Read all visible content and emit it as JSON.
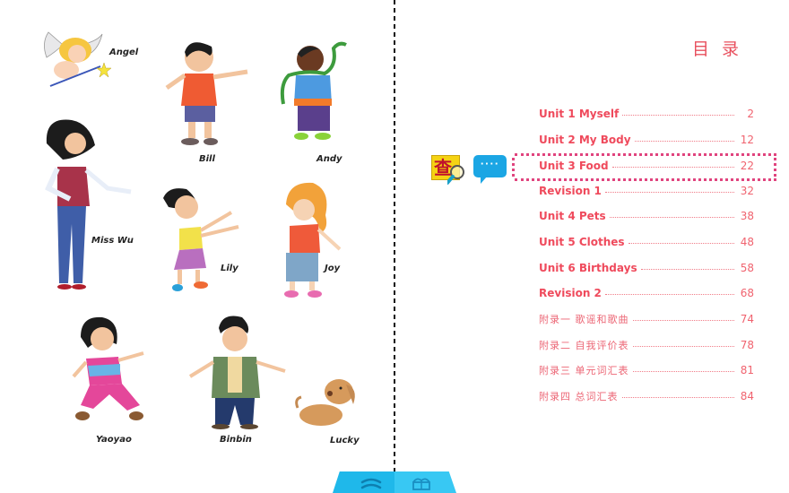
{
  "characters": [
    {
      "id": "angel",
      "name": "Angel"
    },
    {
      "id": "bill",
      "name": "Bill"
    },
    {
      "id": "andy",
      "name": "Andy"
    },
    {
      "id": "miss-wu",
      "name": "Miss Wu"
    },
    {
      "id": "lily",
      "name": "Lily"
    },
    {
      "id": "joy",
      "name": "Joy"
    },
    {
      "id": "yaoyao",
      "name": "Yaoyao"
    },
    {
      "id": "binbin",
      "name": "Binbin"
    },
    {
      "id": "lucky",
      "name": "Lucky"
    }
  ],
  "toc": {
    "title": "目录",
    "entries": [
      {
        "label": "Unit 1 Myself",
        "page": "2",
        "lang": "en"
      },
      {
        "label": "Unit 2 My Body",
        "page": "12",
        "lang": "en"
      },
      {
        "label": "Unit 3 Food",
        "page": "22",
        "lang": "en",
        "highlighted": true
      },
      {
        "label": "Revision 1",
        "page": "32",
        "lang": "en"
      },
      {
        "label": "Unit 4 Pets",
        "page": "38",
        "lang": "en"
      },
      {
        "label": "Unit 5 Clothes",
        "page": "48",
        "lang": "en"
      },
      {
        "label": "Unit 6 Birthdays",
        "page": "58",
        "lang": "en"
      },
      {
        "label": "Revision 2",
        "page": "68",
        "lang": "en"
      },
      {
        "label": "附录一 歌谣和歌曲",
        "page": "74",
        "lang": "cn"
      },
      {
        "label": "附录二 自我评价表",
        "page": "78",
        "lang": "cn"
      },
      {
        "label": "附录三 单元词汇表",
        "page": "81",
        "lang": "cn"
      },
      {
        "label": "附录四 总词汇表",
        "page": "84",
        "lang": "cn"
      }
    ]
  },
  "tools": {
    "lookup_glyph": "查",
    "lookup_icon": "magnifier-icon",
    "chat_glyph": "····",
    "chat_icon": "speech-bubble-icon"
  },
  "bottom_bar": {
    "left_icon": "chevron-double-up-icon",
    "right_icon": "open-book-icon"
  },
  "colors": {
    "toc_text": "#ef4a5c",
    "highlight_dots": "#e0447e",
    "lookup_bg": "#f5d313",
    "chat_bg": "#1ba6e4",
    "toolbar": "#1fb8ea"
  }
}
